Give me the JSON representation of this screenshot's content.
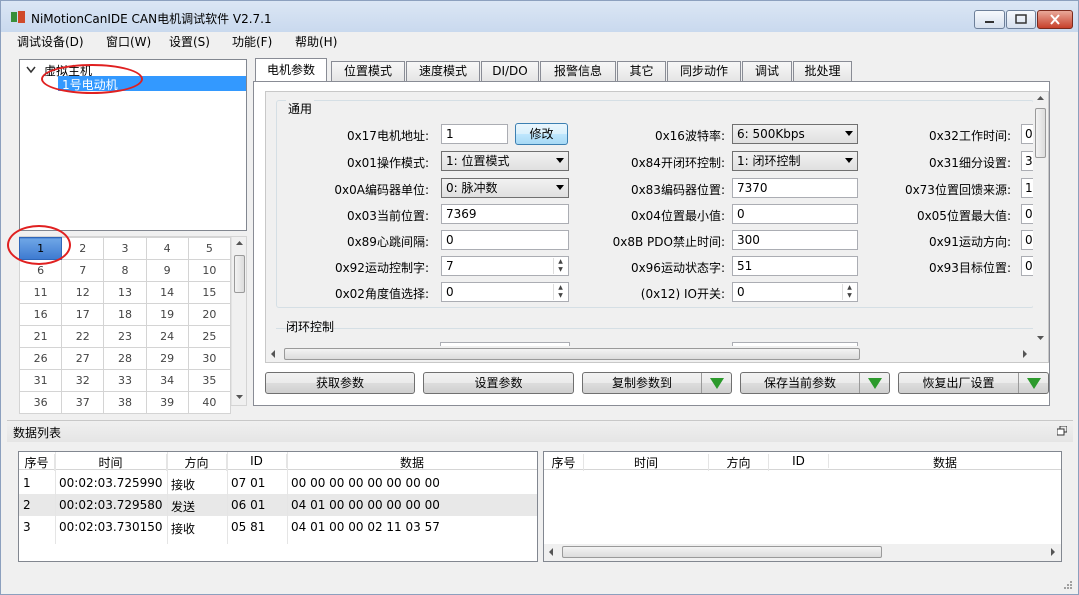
{
  "app": {
    "title": "NiMotionCanIDE CAN电机调试软件 V2.7.1"
  },
  "menu": [
    "调试设备(D)",
    "窗口(W)",
    "设置(S)",
    "功能(F)",
    "帮助(H)"
  ],
  "tree": {
    "root": "虚拟主机",
    "child": "1号电动机"
  },
  "grid": {
    "rows": [
      [
        "1",
        "2",
        "3",
        "4",
        "5"
      ],
      [
        "6",
        "7",
        "8",
        "9",
        "10"
      ],
      [
        "11",
        "12",
        "13",
        "14",
        "15"
      ],
      [
        "16",
        "17",
        "18",
        "19",
        "20"
      ],
      [
        "21",
        "22",
        "23",
        "24",
        "25"
      ],
      [
        "26",
        "27",
        "28",
        "29",
        "30"
      ],
      [
        "31",
        "32",
        "33",
        "34",
        "35"
      ],
      [
        "36",
        "37",
        "38",
        "39",
        "40"
      ]
    ],
    "selected": "1"
  },
  "tabs": [
    "电机参数",
    "位置模式",
    "速度模式",
    "DI/DO",
    "报警信息",
    "其它",
    "同步动作",
    "调试",
    "批处理"
  ],
  "params": {
    "section_general": "通用",
    "section_closed": "闭环控制",
    "addr_label": "0x17电机地址:",
    "addr_value": "1",
    "modify_btn": "修改",
    "baud_label": "0x16波特率:",
    "baud_value": "6: 500Kbps",
    "worktime_label": "0x32工作时间:",
    "worktime_value": "0",
    "opmode_label": "0x01操作模式:",
    "opmode_value": "1: 位置模式",
    "loop_label": "0x84开闭环控制:",
    "loop_value": "1: 闭环控制",
    "subdiv_label": "0x31细分设置:",
    "subdiv_value": "3",
    "encunit_label": "0x0A编码器单位:",
    "encunit_value": "0: 脉冲数",
    "encpos_label": "0x83编码器位置:",
    "encpos_value": "7370",
    "fbsrc_label": "0x73位置回馈来源:",
    "fbsrc_value": "1",
    "curpos_label": "0x03当前位置:",
    "curpos_value": "7369",
    "minpos_label": "0x04位置最小值:",
    "minpos_value": "0",
    "maxpos_label": "0x05位置最大值:",
    "maxpos_value": "0",
    "hb_label": "0x89心跳间隔:",
    "hb_value": "0",
    "pdo_label": "0x8B PDO禁止时间:",
    "pdo_value": "300",
    "dir_label": "0x91运动方向:",
    "dir_value": "0",
    "ctrl_label": "0x92运动控制字:",
    "ctrl_value": "7",
    "status_label": "0x96运动状态字:",
    "status_value": "51",
    "target_label": "0x93目标位置:",
    "target_value": "0",
    "angle_label": "0x02角度值选择:",
    "angle_value": "0",
    "io_label": "(0x12) IO开关:",
    "io_value": "0"
  },
  "buttons": {
    "get": "获取参数",
    "set": "设置参数",
    "copy": "复制参数到",
    "save": "保存当前参数",
    "restore": "恢复出厂设置"
  },
  "datalist": {
    "title": "数据列表",
    "headers": [
      "序号",
      "时间",
      "方向",
      "ID",
      "数据"
    ],
    "rows": [
      [
        "1",
        "00:02:03.725990",
        "接收",
        "07 01",
        "00 00 00 00 00 00 00 00"
      ],
      [
        "2",
        "00:02:03.729580",
        "发送",
        "06 01",
        "04 01 00 00 00 00 00 00"
      ],
      [
        "3",
        "00:02:03.730150",
        "接收",
        "05 81",
        "04 01 00 00 02 11 03 57"
      ]
    ]
  }
}
